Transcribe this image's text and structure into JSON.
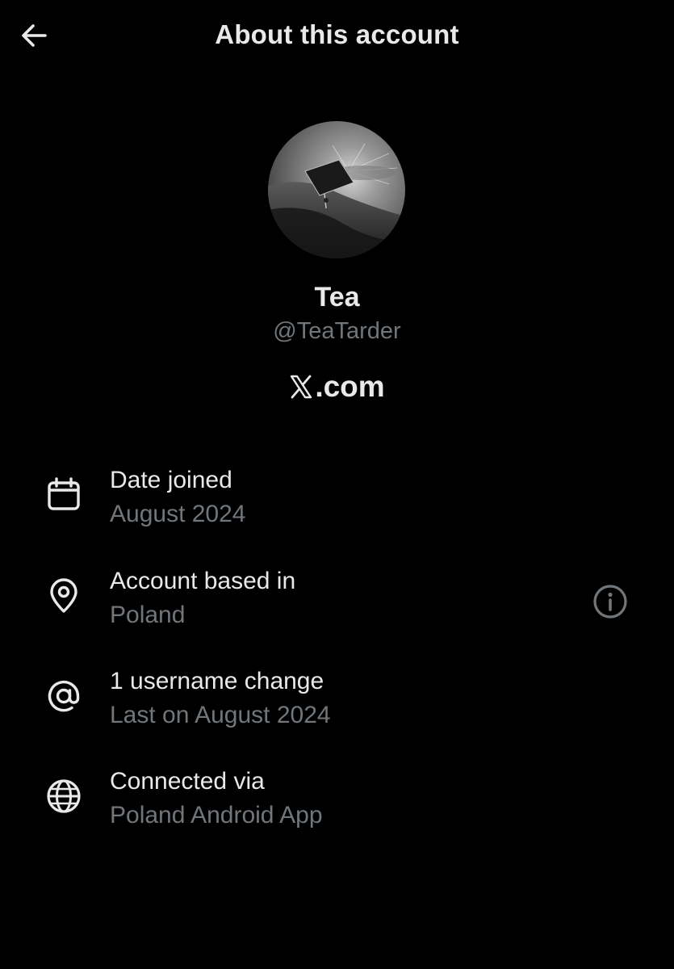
{
  "header": {
    "title": "About this account",
    "back_icon": "arrow-left-icon"
  },
  "profile": {
    "display_name": "Tea",
    "handle": "@TeaTarder",
    "platform_suffix": ".com",
    "platform_logo": "x-logo-icon"
  },
  "details": [
    {
      "icon": "calendar-icon",
      "label": "Date joined",
      "value": "August 2024"
    },
    {
      "icon": "location-pin-icon",
      "label": "Account based in",
      "value": "Poland",
      "action_icon": "info-icon"
    },
    {
      "icon": "at-sign-icon",
      "label": "1 username change",
      "value": "Last on August 2024"
    },
    {
      "icon": "globe-icon",
      "label": "Connected via",
      "value": "Poland Android App"
    }
  ],
  "colors": {
    "background": "#000000",
    "primary_text": "#e7e9ea",
    "secondary_text": "#71767b"
  }
}
